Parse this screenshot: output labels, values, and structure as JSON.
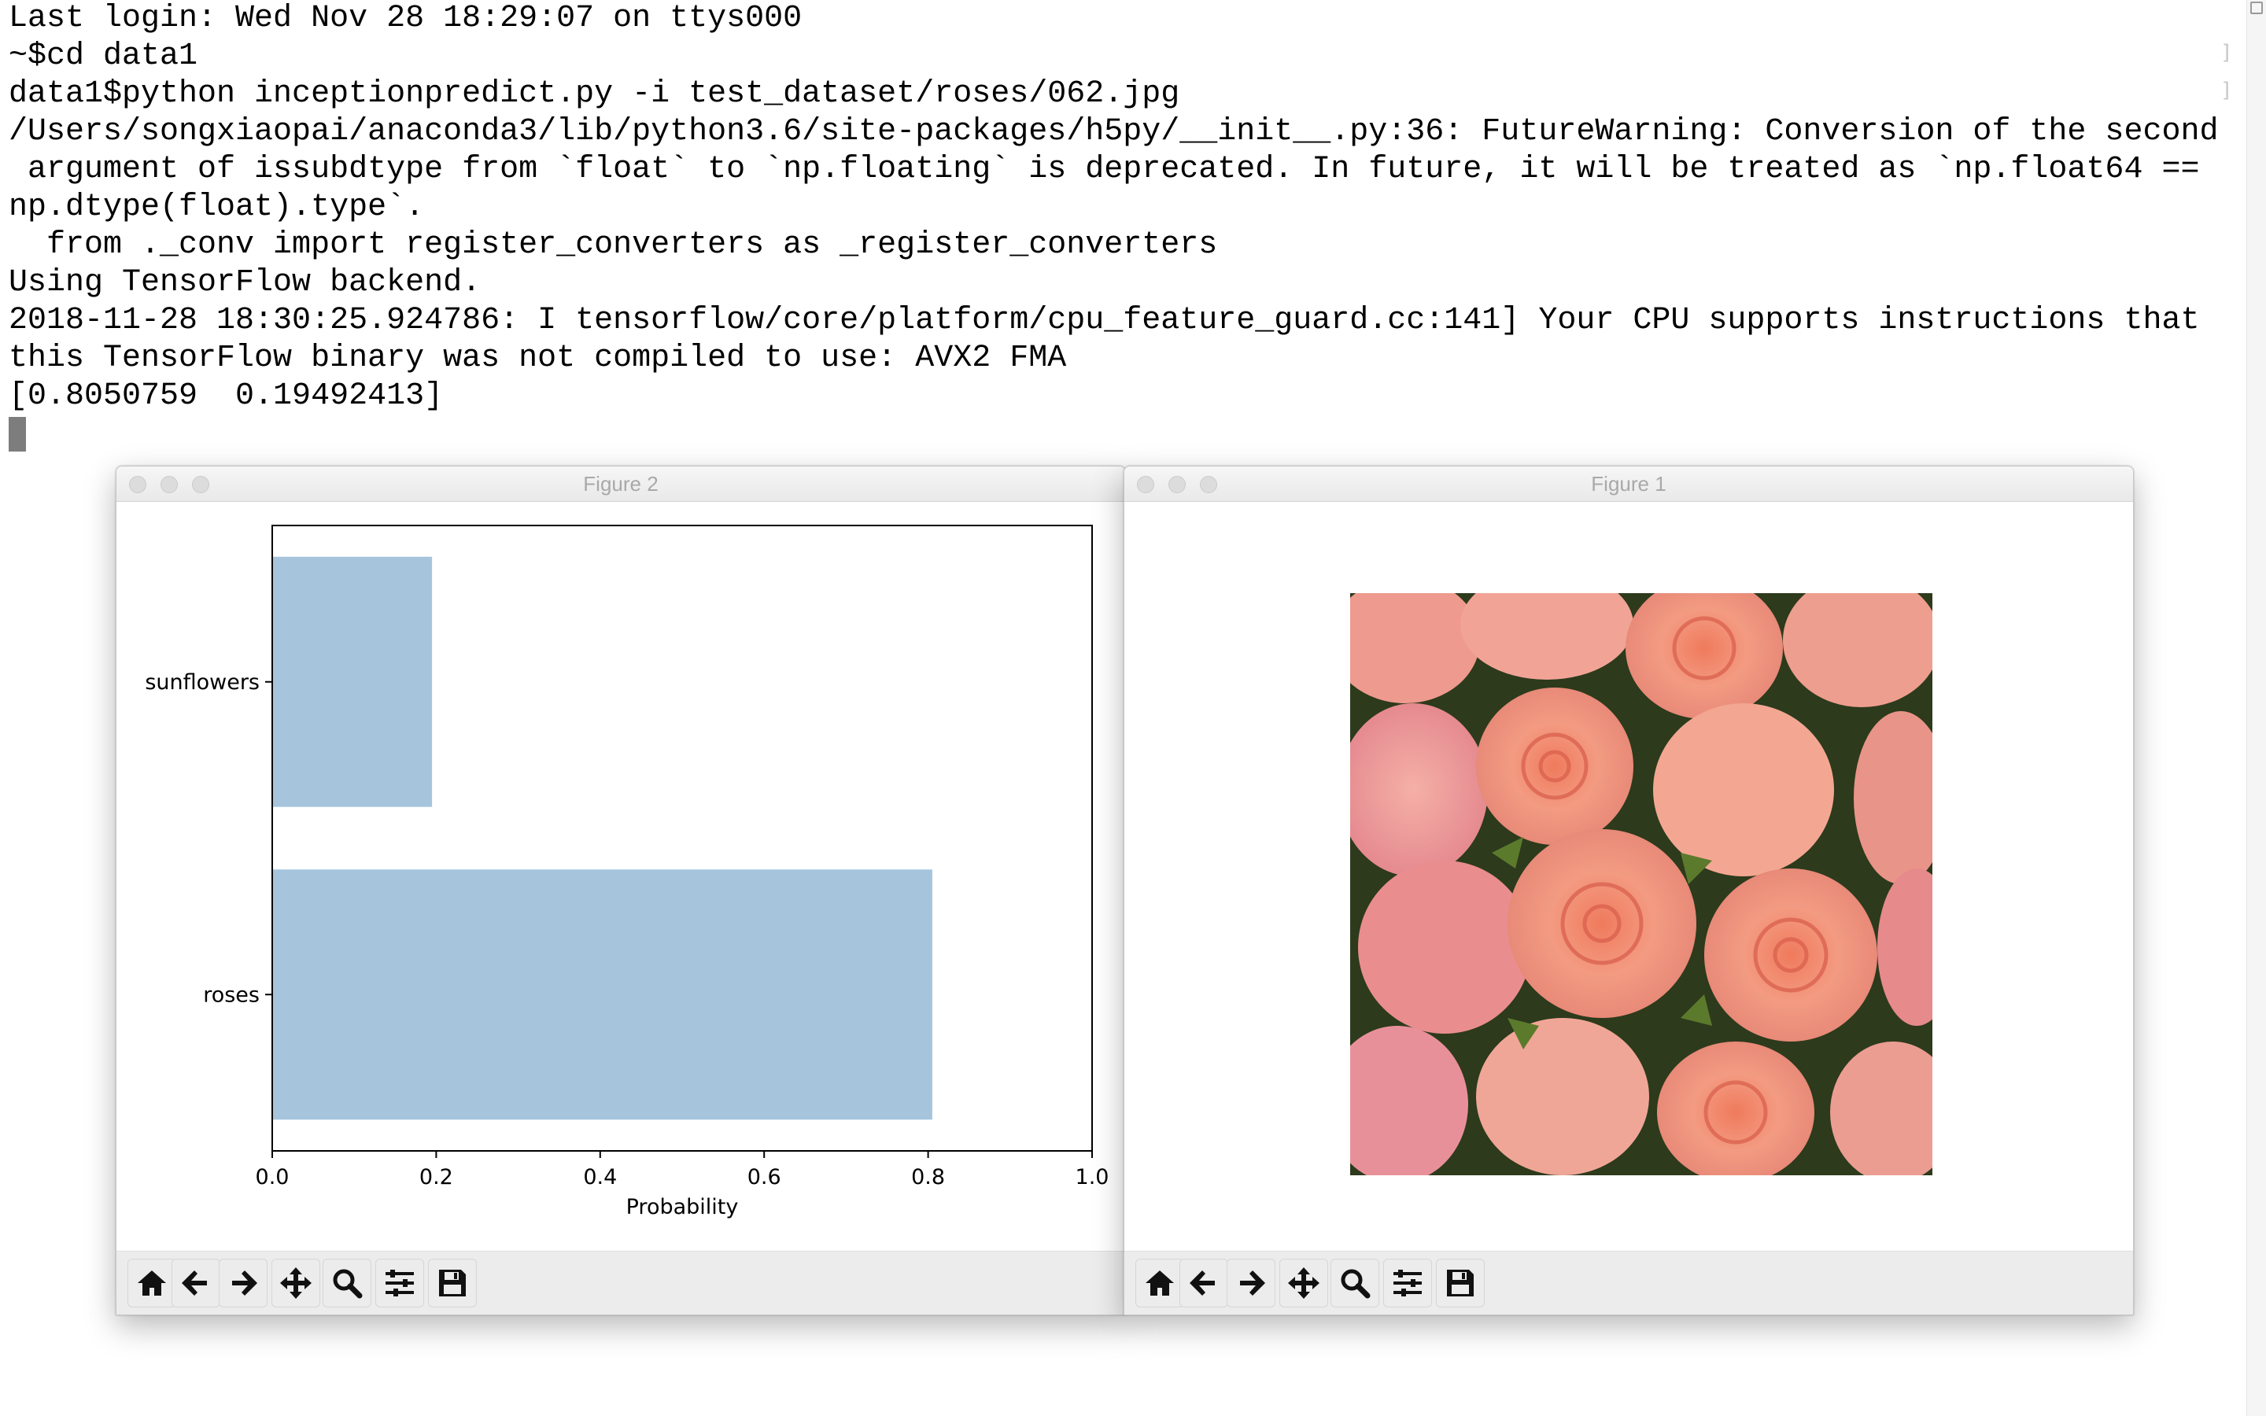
{
  "terminal": {
    "lines": [
      "Last login: Wed Nov 28 18:29:07 on ttys000",
      "~$cd data1",
      "data1$python inceptionpredict.py -i test_dataset/roses/062.jpg",
      "/Users/songxiaopai/anaconda3/lib/python3.6/site-packages/h5py/__init__.py:36: FutureWarning: Conversion of the second",
      " argument of issubdtype from `float` to `np.floating` is deprecated. In future, it will be treated as `np.float64 ==",
      "np.dtype(float).type`.",
      "  from ._conv import register_converters as _register_converters",
      "Using TensorFlow backend.",
      "2018-11-28 18:30:25.924786: I tensorflow/core/platform/cpu_feature_guard.cc:141] Your CPU supports instructions that",
      "this TensorFlow binary was not compiled to use: AVX2 FMA",
      "[0.8050759  0.19492413]"
    ],
    "side_marks": [
      "]",
      "]"
    ]
  },
  "figure2": {
    "title": "Figure 2"
  },
  "figure1": {
    "title": "Figure 1",
    "image_description_icon": "rose-photo"
  },
  "toolbar_icons": [
    "home-icon",
    "back-arrow-icon",
    "forward-arrow-icon",
    "pan-icon",
    "zoom-icon",
    "configure-icon",
    "save-icon"
  ],
  "colors": {
    "bar": "#a6c5dd",
    "title_text": "#a9a9a9",
    "toolbar_bg": "#ececec"
  },
  "chart_data": {
    "type": "bar",
    "orientation": "horizontal",
    "categories": [
      "roses",
      "sunflowers"
    ],
    "values": [
      0.8050759,
      0.19492413
    ],
    "xlabel": "Probability",
    "ylabel": "",
    "xlim": [
      0,
      1.0
    ],
    "xticks": [
      "0.0",
      "0.2",
      "0.4",
      "0.6",
      "0.8",
      "1.0"
    ],
    "grid": false,
    "color": "#a6c5dd"
  }
}
